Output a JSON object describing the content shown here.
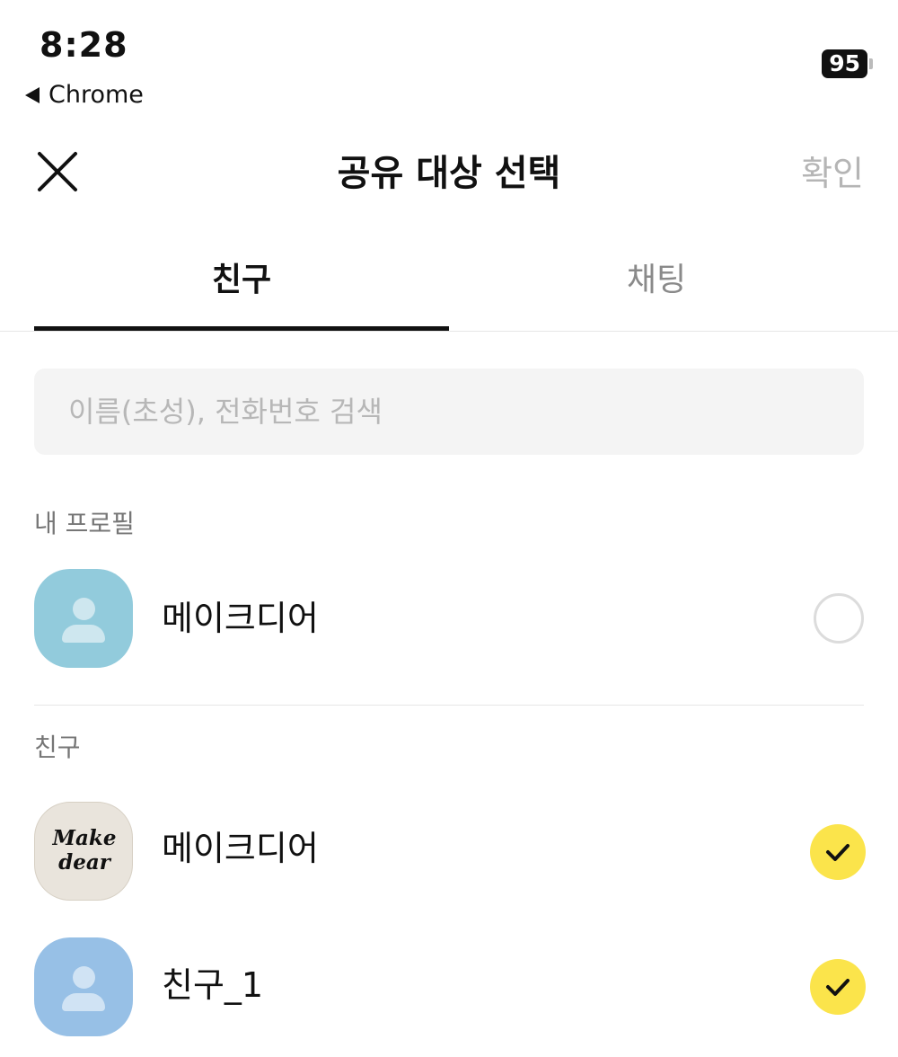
{
  "status_bar": {
    "time": "8:28",
    "back_app": "Chrome",
    "battery": "95"
  },
  "header": {
    "title": "공유 대상 선택",
    "confirm_label": "확인"
  },
  "tabs": [
    {
      "label": "친구",
      "selected": true
    },
    {
      "label": "채팅",
      "selected": false
    }
  ],
  "search": {
    "placeholder": "이름(초성), 전화번호 검색",
    "value": ""
  },
  "my_profile": {
    "section_label": "내 프로필",
    "item": {
      "name": "메이크디어",
      "selected": false,
      "avatar": "default-person-avatar"
    }
  },
  "friends": {
    "section_label": "친구",
    "items": [
      {
        "name": "메이크디어",
        "selected": true,
        "avatar": "makedear-logo-avatar",
        "logo_text": "Make dear"
      },
      {
        "name": "친구_1",
        "selected": true,
        "avatar": "default-person-avatar"
      }
    ]
  },
  "colors": {
    "check_yellow": "#fbe44b",
    "disabled_gray": "#b5b5b5",
    "avatar_teal": "#92cbdc",
    "avatar_blue": "#97c0e6"
  }
}
